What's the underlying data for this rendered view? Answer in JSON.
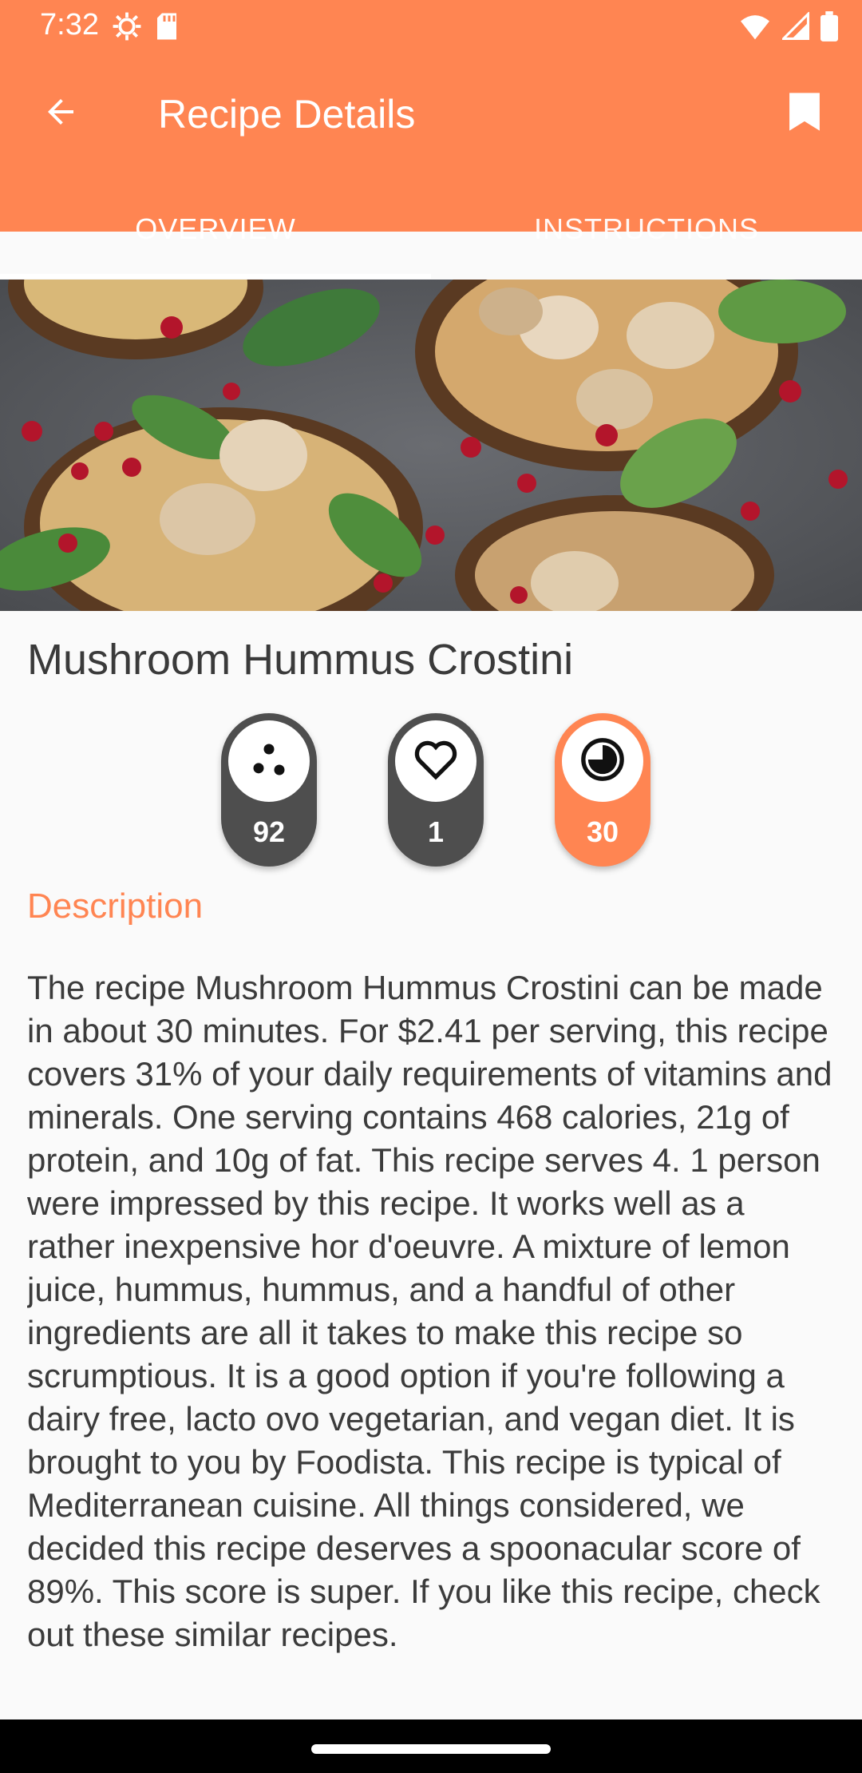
{
  "status": {
    "time": "7:32"
  },
  "app_bar": {
    "title": "Recipe Details"
  },
  "tabs": [
    {
      "label": "OVERVIEW"
    },
    {
      "label": "INSTRUCTIONS"
    }
  ],
  "recipe": {
    "title": "Mushroom Hummus Crostini",
    "stats": [
      {
        "icon": "dots-icon",
        "value": "92"
      },
      {
        "icon": "heart-icon",
        "value": "1"
      },
      {
        "icon": "clock-icon",
        "value": "30"
      }
    ],
    "description_heading": "Description",
    "description": "The recipe Mushroom Hummus Crostini can be made in about 30 minutes. For $2.41 per serving, this recipe covers 31% of your daily requirements of vitamins and minerals. One serving contains 468 calories, 21g of protein, and 10g of fat. This recipe serves 4. 1 person were impressed by this recipe. It works well as a rather inexpensive hor d'oeuvre. A mixture of lemon juice, hummus, hummus, and a handful of other ingredients are all it takes to make this recipe so scrumptious. It is a good option if you're following a dairy free, lacto ovo vegetarian, and vegan diet. It is brought to you by Foodista. This recipe is typical of Mediterranean cuisine. All things considered, we decided this recipe deserves a spoonacular score of 89%. This score is super. If you like this recipe, check out these similar recipes."
  },
  "colors": {
    "accent": "#ff8552",
    "dark_pill": "#4e4e4e",
    "text": "#3b3b3b"
  }
}
